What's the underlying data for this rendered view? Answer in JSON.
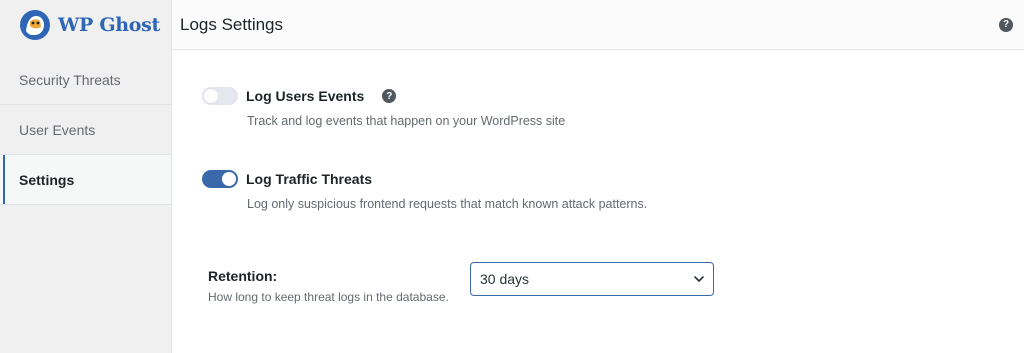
{
  "brand": {
    "name": "WP Ghost",
    "logo_icon": "ghost-logo-icon"
  },
  "sidebar": {
    "items": [
      {
        "label": "Security Threats",
        "active": false
      },
      {
        "label": "User Events",
        "active": false
      },
      {
        "label": "Settings",
        "active": true
      }
    ]
  },
  "header": {
    "title": "Logs Settings",
    "help_icon": "question-circle-icon",
    "help_glyph": "?"
  },
  "settings": {
    "log_users_events": {
      "label": "Log Users Events",
      "description": "Track and log events that happen on your WordPress site",
      "enabled": false,
      "help_glyph": "?"
    },
    "log_traffic_threats": {
      "label": "Log Traffic Threats",
      "description": "Log only suspicious frontend requests that match known attack patterns.",
      "enabled": true
    },
    "retention": {
      "label": "Retention:",
      "description": "How long to keep threat logs in the database.",
      "selected_value": "30 days"
    }
  },
  "colors": {
    "accent": "#3a68aa",
    "brand": "#2e65b5",
    "text": "#1d2327",
    "muted": "#646970"
  }
}
